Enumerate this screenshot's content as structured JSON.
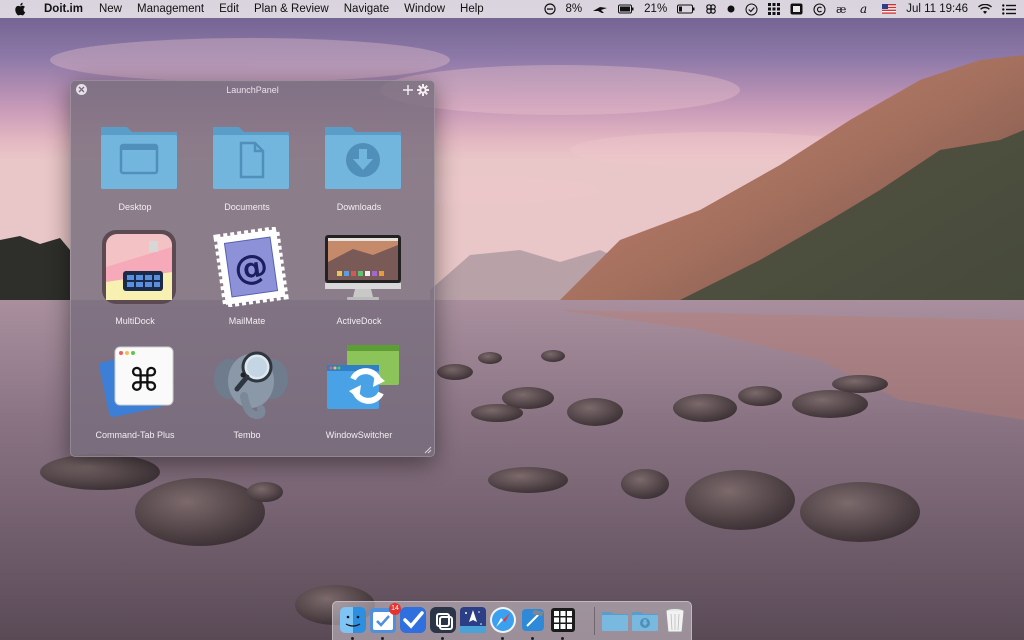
{
  "menubar": {
    "app_name": "Doit.im",
    "menus": [
      "New",
      "Management",
      "Edit",
      "Plan & Review",
      "Navigate",
      "Window",
      "Help"
    ],
    "status": {
      "dnd_percent": "8%",
      "battery_percent": "21%",
      "datetime": "Jul 11  19:46"
    },
    "status_icons": [
      "minus-circle-icon",
      "cloud-plane-icon",
      "battery-icon",
      "clover-icon",
      "dot-icon",
      "checkmark-box-icon",
      "grid-icon",
      "window-switch-icon",
      "copyright-icon",
      "ae-ligature-icon",
      "script-a-icon",
      "us-flag-icon",
      "wifi-icon",
      "list-icon"
    ]
  },
  "panel": {
    "title": "LaunchPanel",
    "items": [
      {
        "label": "Desktop",
        "icon": "desktop-folder-icon"
      },
      {
        "label": "Documents",
        "icon": "documents-folder-icon"
      },
      {
        "label": "Downloads",
        "icon": "downloads-folder-icon"
      },
      {
        "label": "MultiDock",
        "icon": "multidock-icon"
      },
      {
        "label": "MailMate",
        "icon": "mailmate-icon"
      },
      {
        "label": "ActiveDock",
        "icon": "activedock-icon"
      },
      {
        "label": "Command-Tab Plus",
        "icon": "command-tab-plus-icon"
      },
      {
        "label": "Tembo",
        "icon": "tembo-icon"
      },
      {
        "label": "WindowSwitcher",
        "icon": "windowswitcher-icon"
      }
    ]
  },
  "dock": {
    "mail_badge": "14",
    "items": [
      "finder-icon",
      "doit-tasks-icon",
      "blue-check-icon",
      "multidock-dark-icon",
      "launchpad-rocket-icon",
      "safari-icon",
      "xcode-icon",
      "grid-app-icon",
      "apps-folder-icon",
      "downloads-stack-icon",
      "trash-icon"
    ]
  },
  "colors": {
    "folder_blue": "#6fb2d9",
    "folder_blue_dark": "#4f8fba",
    "menubar_bg": "#ece8ec",
    "badge_red": "#e5342f"
  }
}
